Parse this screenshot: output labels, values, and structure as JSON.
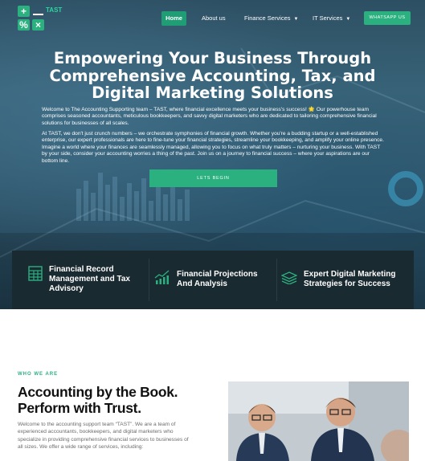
{
  "brand": {
    "cells": [
      "+",
      "−",
      "%",
      "×"
    ],
    "name": "TAST"
  },
  "nav": {
    "home": "Home",
    "about": "About us",
    "finance": "Finance Services",
    "it": "IT Services",
    "whatsapp": "WHATSAPP US"
  },
  "hero": {
    "title": "Empowering Your Business Through Comprehensive Accounting, Tax, and Digital Marketing Solutions",
    "p1": "Welcome to The Accounting Supporting team – TAST, where financial excellence meets your business's success! 🌟 Our powerhouse team comprises seasoned accountants, meticulous bookkeepers, and savvy digital marketers who are dedicated to tailoring comprehensive financial solutions for businesses of all scales.",
    "p2": "At TAST, we don't just crunch numbers – we orchestrate symphonies of financial growth. Whether you're a budding startup or a well-established enterprise, our expert professionals are here to fine-tune your financial strategies, streamline your bookkeeping, and amplify your online presence. Imagine a world where your finances are seamlessly managed, allowing you to focus on what truly matters – nurturing your business. With TAST by your side, consider your accounting worries a thing of the past. Join us on a journey to financial success – where your aspirations are our bottom line.",
    "cta": "LETS BEGIN"
  },
  "features": [
    {
      "icon": "spreadsheet-icon",
      "label": "Financial Record Management and Tax Advisory"
    },
    {
      "icon": "bar-chart-icon",
      "label": "Financial Projections And Analysis"
    },
    {
      "icon": "layers-icon",
      "label": "Expert Digital Marketing Strategies for Success"
    }
  ],
  "about": {
    "eyebrow": "WHO WE ARE",
    "title": "Accounting by the Book. Perform with Trust.",
    "text": "Welcome to the accounting support team “TAST”. We are a team of experienced accountants, bookkeepers, and digital marketers who specialize in providing comprehensive financial services to businesses of all sizes. We offer a wide range of services, including:"
  },
  "colors": {
    "accent": "#2bb07f",
    "strip": "#1a2a31",
    "heading": "#111111",
    "body_text": "#6c6c6c"
  }
}
